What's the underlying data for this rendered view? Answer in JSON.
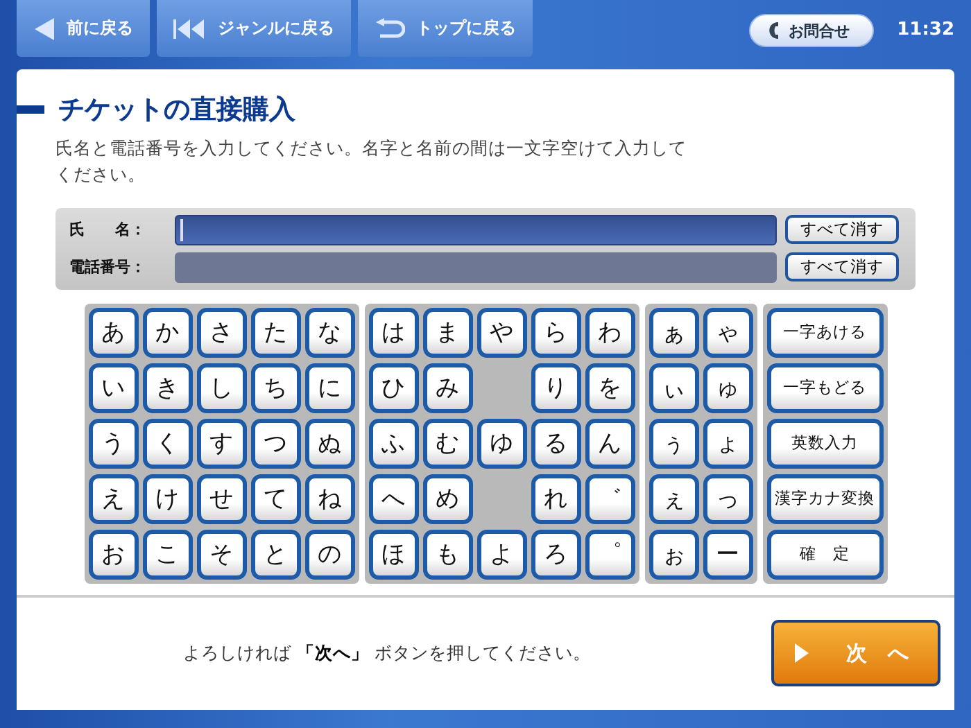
{
  "nav_buttons": [
    {
      "kind": "back",
      "label": "前に戻る"
    },
    {
      "kind": "genre",
      "label": "ジャンルに戻る"
    },
    {
      "kind": "top",
      "label": "トップに戻る"
    }
  ],
  "contact_button": {
    "label": "お問合せ"
  },
  "clock": "11:32",
  "title": "チケットの直接購入",
  "instructions": "氏名と電話番号を入力してください。名字と名前の間は一文字空けて入力してください。",
  "fields": [
    {
      "label": "氏　　名：",
      "selected": true,
      "clear_button": "すべて消す"
    },
    {
      "label": "電話番号：",
      "selected": false,
      "clear_button": "すべて消す"
    }
  ],
  "keyboard": {
    "blocks": [
      {
        "kind": "kana",
        "keys": [
          {
            "kind": "key",
            "label": "あ"
          },
          {
            "kind": "key",
            "label": "か"
          },
          {
            "kind": "key",
            "label": "さ"
          },
          {
            "kind": "key",
            "label": "た"
          },
          {
            "kind": "key",
            "label": "な"
          },
          {
            "kind": "key",
            "label": "い"
          },
          {
            "kind": "key",
            "label": "き"
          },
          {
            "kind": "key",
            "label": "し"
          },
          {
            "kind": "key",
            "label": "ち"
          },
          {
            "kind": "key",
            "label": "に"
          },
          {
            "kind": "key",
            "label": "う"
          },
          {
            "kind": "key",
            "label": "く"
          },
          {
            "kind": "key",
            "label": "す"
          },
          {
            "kind": "key",
            "label": "つ"
          },
          {
            "kind": "key",
            "label": "ぬ"
          },
          {
            "kind": "key",
            "label": "え"
          },
          {
            "kind": "key",
            "label": "け"
          },
          {
            "kind": "key",
            "label": "せ"
          },
          {
            "kind": "key",
            "label": "て"
          },
          {
            "kind": "key",
            "label": "ね"
          },
          {
            "kind": "key",
            "label": "お"
          },
          {
            "kind": "key",
            "label": "こ"
          },
          {
            "kind": "key",
            "label": "そ"
          },
          {
            "kind": "key",
            "label": "と"
          },
          {
            "kind": "key",
            "label": "の"
          }
        ]
      },
      {
        "kind": "kana",
        "keys": [
          {
            "kind": "key",
            "label": "は"
          },
          {
            "kind": "key",
            "label": "ま"
          },
          {
            "kind": "key",
            "label": "や"
          },
          {
            "kind": "key",
            "label": "ら"
          },
          {
            "kind": "key",
            "label": "わ"
          },
          {
            "kind": "key",
            "label": "ひ"
          },
          {
            "kind": "key",
            "label": "み"
          },
          {
            "kind": "gap"
          },
          {
            "kind": "key",
            "label": "り"
          },
          {
            "kind": "key",
            "label": "を"
          },
          {
            "kind": "key",
            "label": "ふ"
          },
          {
            "kind": "key",
            "label": "む"
          },
          {
            "kind": "key",
            "label": "ゆ"
          },
          {
            "kind": "key",
            "label": "る"
          },
          {
            "kind": "key",
            "label": "ん"
          },
          {
            "kind": "key",
            "label": "へ"
          },
          {
            "kind": "key",
            "label": "め"
          },
          {
            "kind": "gap"
          },
          {
            "kind": "key",
            "label": "れ"
          },
          {
            "kind": "key",
            "label": "゛"
          },
          {
            "kind": "key",
            "label": "ほ"
          },
          {
            "kind": "key",
            "label": "も"
          },
          {
            "kind": "key",
            "label": "よ"
          },
          {
            "kind": "key",
            "label": "ろ"
          },
          {
            "kind": "key",
            "label": "゜"
          }
        ]
      },
      {
        "kind": "small",
        "keys": [
          {
            "kind": "key",
            "label": "ぁ"
          },
          {
            "kind": "key",
            "label": "ゃ"
          },
          {
            "kind": "key",
            "label": "ぃ"
          },
          {
            "kind": "key",
            "label": "ゅ"
          },
          {
            "kind": "key",
            "label": "ぅ"
          },
          {
            "kind": "key",
            "label": "ょ"
          },
          {
            "kind": "key",
            "label": "ぇ"
          },
          {
            "kind": "key",
            "label": "っ"
          },
          {
            "kind": "key",
            "label": "ぉ"
          },
          {
            "kind": "key",
            "label": "ー"
          }
        ]
      },
      {
        "kind": "function",
        "keys": [
          {
            "kind": "function",
            "label": "一字あける"
          },
          {
            "kind": "function",
            "label": "一字もどる"
          },
          {
            "kind": "function",
            "label": "英数入力"
          },
          {
            "kind": "function",
            "label": "漢字カナ変換"
          },
          {
            "kind": "function",
            "label": "確　定"
          }
        ]
      }
    ]
  },
  "footer_message": "よろしければ **「次へ」** ボタンを押してください。",
  "next_button": {
    "label": "次　へ"
  }
}
